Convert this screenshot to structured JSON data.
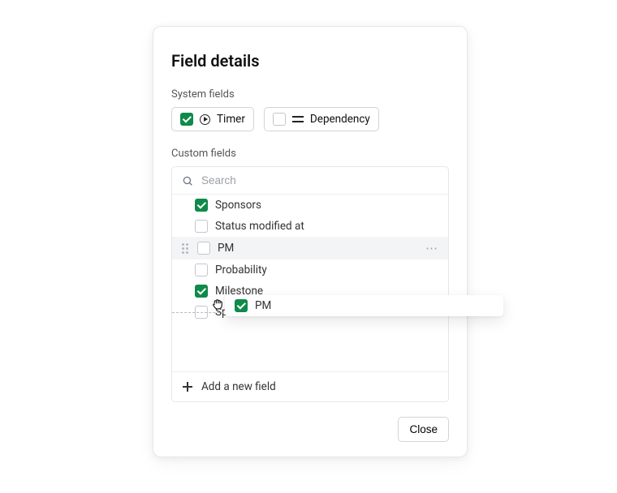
{
  "title": "Field details",
  "sections": {
    "system_label": "System fields",
    "custom_label": "Custom fields"
  },
  "system_fields": [
    {
      "label": "Timer",
      "checked": true,
      "icon": "play-icon"
    },
    {
      "label": "Dependency",
      "checked": false,
      "icon": "swap-icon"
    }
  ],
  "search": {
    "placeholder": "Search"
  },
  "custom_fields": [
    {
      "label": "Sponsors",
      "checked": true
    },
    {
      "label": "Status modified at",
      "checked": false
    },
    {
      "label": "PM",
      "checked": false,
      "highlight": true
    },
    {
      "label": "Probability",
      "checked": false
    },
    {
      "label": "Milestone",
      "checked": true
    },
    {
      "label": "Sprint",
      "checked": false
    }
  ],
  "dragging": {
    "label": "PM",
    "checked": true
  },
  "actions": {
    "add_label": "Add a new field",
    "close_label": "Close"
  }
}
